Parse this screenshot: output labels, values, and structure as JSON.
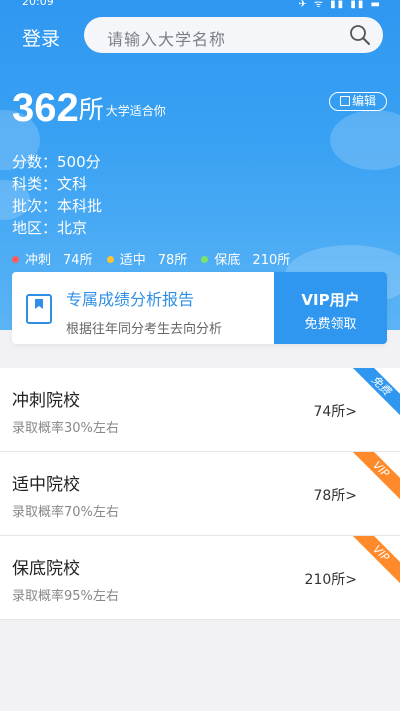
{
  "status_bar": {
    "time": "20:09",
    "icons": "✈ ᯤ ▮▮ ▮▮ ▬"
  },
  "header": {
    "login_label": "登录",
    "search_placeholder": "请输入大学名称"
  },
  "summary": {
    "count": "362",
    "unit": "所",
    "suffix": "大学适合你",
    "edit_label": "编辑",
    "score": "分数：500分",
    "subject": "科类：文科",
    "batch": "批次：本科批",
    "region": "地区：北京"
  },
  "legend": [
    {
      "label": "冲刺",
      "count": "74所",
      "color": "#ff5b5b"
    },
    {
      "label": "适中",
      "count": "78所",
      "color": "#ffc233"
    },
    {
      "label": "保底",
      "count": "210所",
      "color": "#7be36b"
    }
  ],
  "report_card": {
    "title": "专属成绩分析报告",
    "subtitle": "根据往年同分考生去向分析",
    "vip_title": "VIP用户",
    "vip_sub": "免费领取"
  },
  "colleges": [
    {
      "name": "冲刺院校",
      "rate": "录取概率30%左右",
      "count": "74所>",
      "ribbon": "免费",
      "ribbon_color": "#2f97f0"
    },
    {
      "name": "适中院校",
      "rate": "录取概率70%左右",
      "count": "78所>",
      "ribbon": "VIP",
      "ribbon_color": "#ff8a2b"
    },
    {
      "name": "保底院校",
      "rate": "录取概率95%左右",
      "count": "210所>",
      "ribbon": "VIP",
      "ribbon_color": "#ff8a2b"
    }
  ]
}
